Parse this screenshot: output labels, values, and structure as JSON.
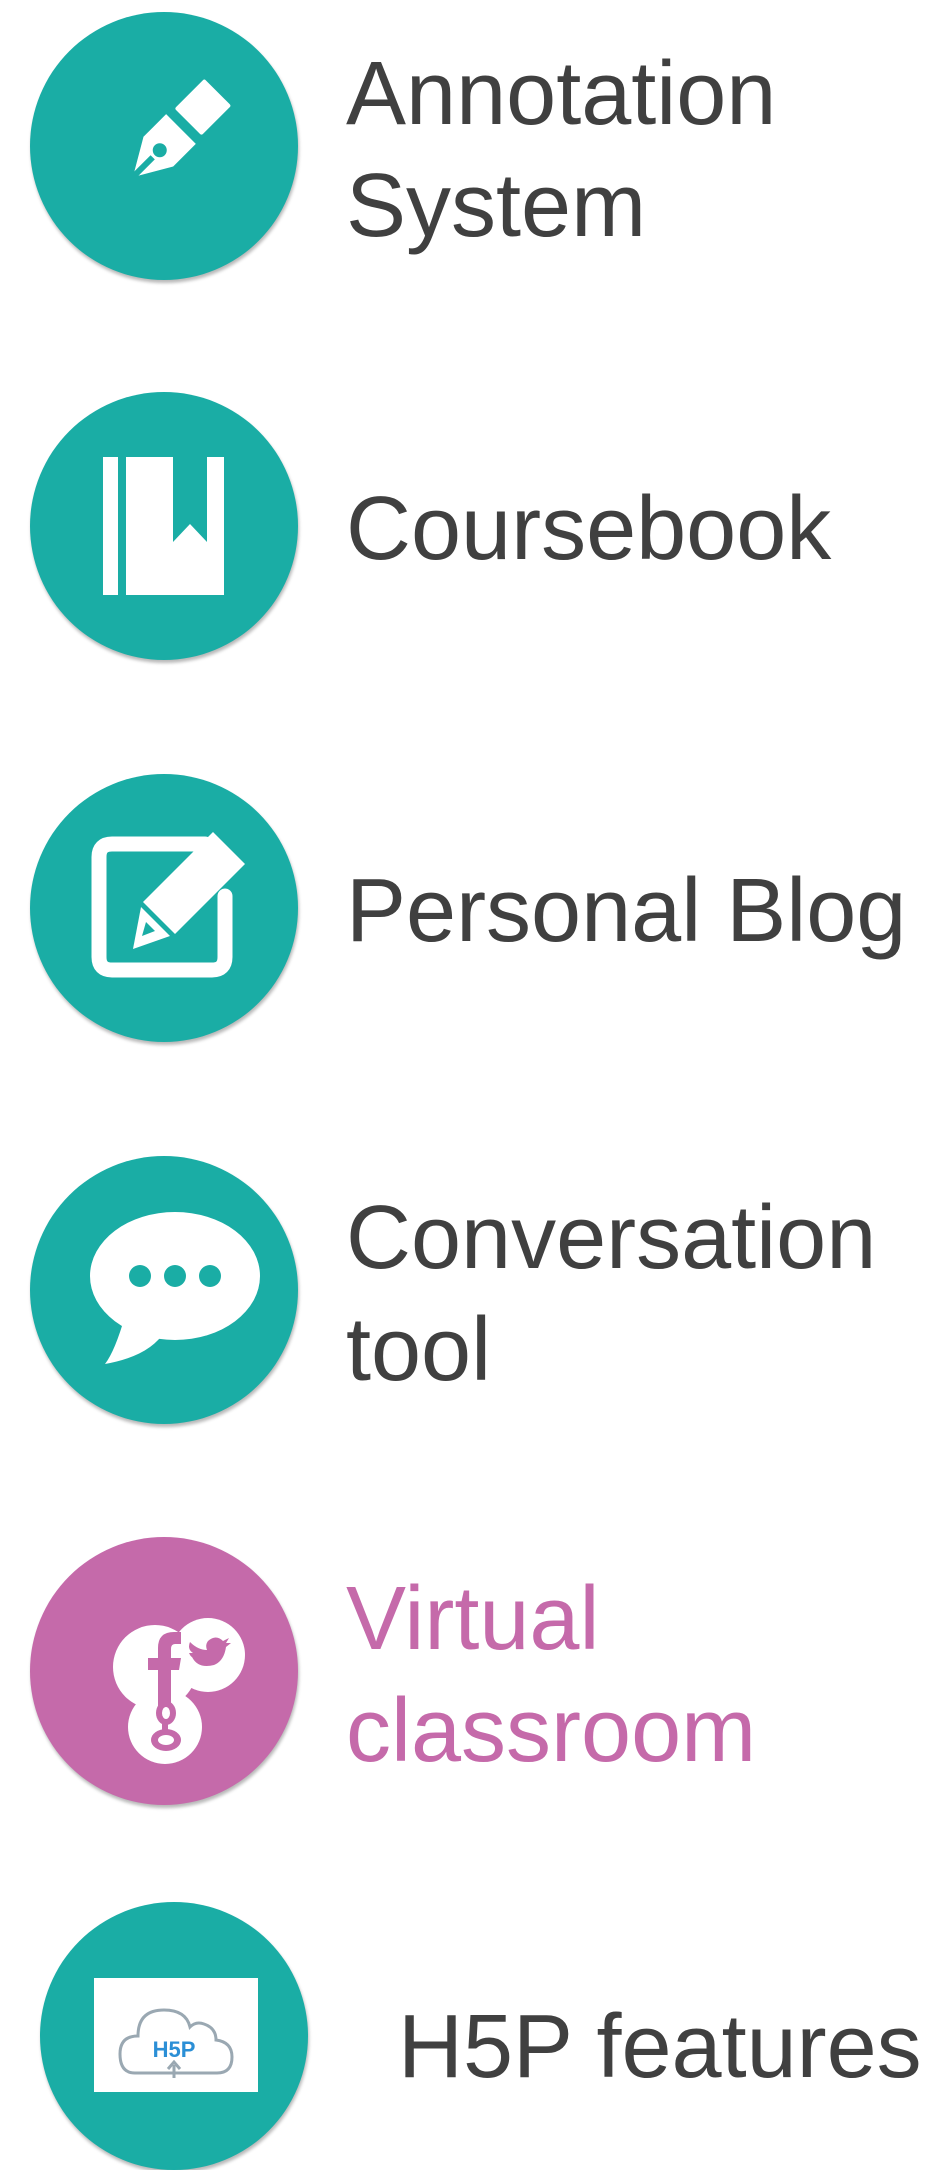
{
  "colors": {
    "teal": "#1aada5",
    "pink": "#c56aaa",
    "text": "#404040"
  },
  "items": [
    {
      "icon": "pen-nib-icon",
      "lines": [
        "Annotation",
        "System"
      ]
    },
    {
      "icon": "bookmark-book-icon",
      "lines": [
        "Coursebook"
      ]
    },
    {
      "icon": "edit-square-pencil-icon",
      "lines": [
        "Personal Blog"
      ]
    },
    {
      "icon": "speech-bubble-icon",
      "lines": [
        "Conversation",
        "tool"
      ]
    },
    {
      "icon": "social-networks-icon",
      "lines": [
        "Virtual",
        "classroom"
      ]
    },
    {
      "icon": "h5p-cloud-icon",
      "lines": [
        "H5P features"
      ]
    }
  ],
  "h5p_logo_text": "H5P"
}
